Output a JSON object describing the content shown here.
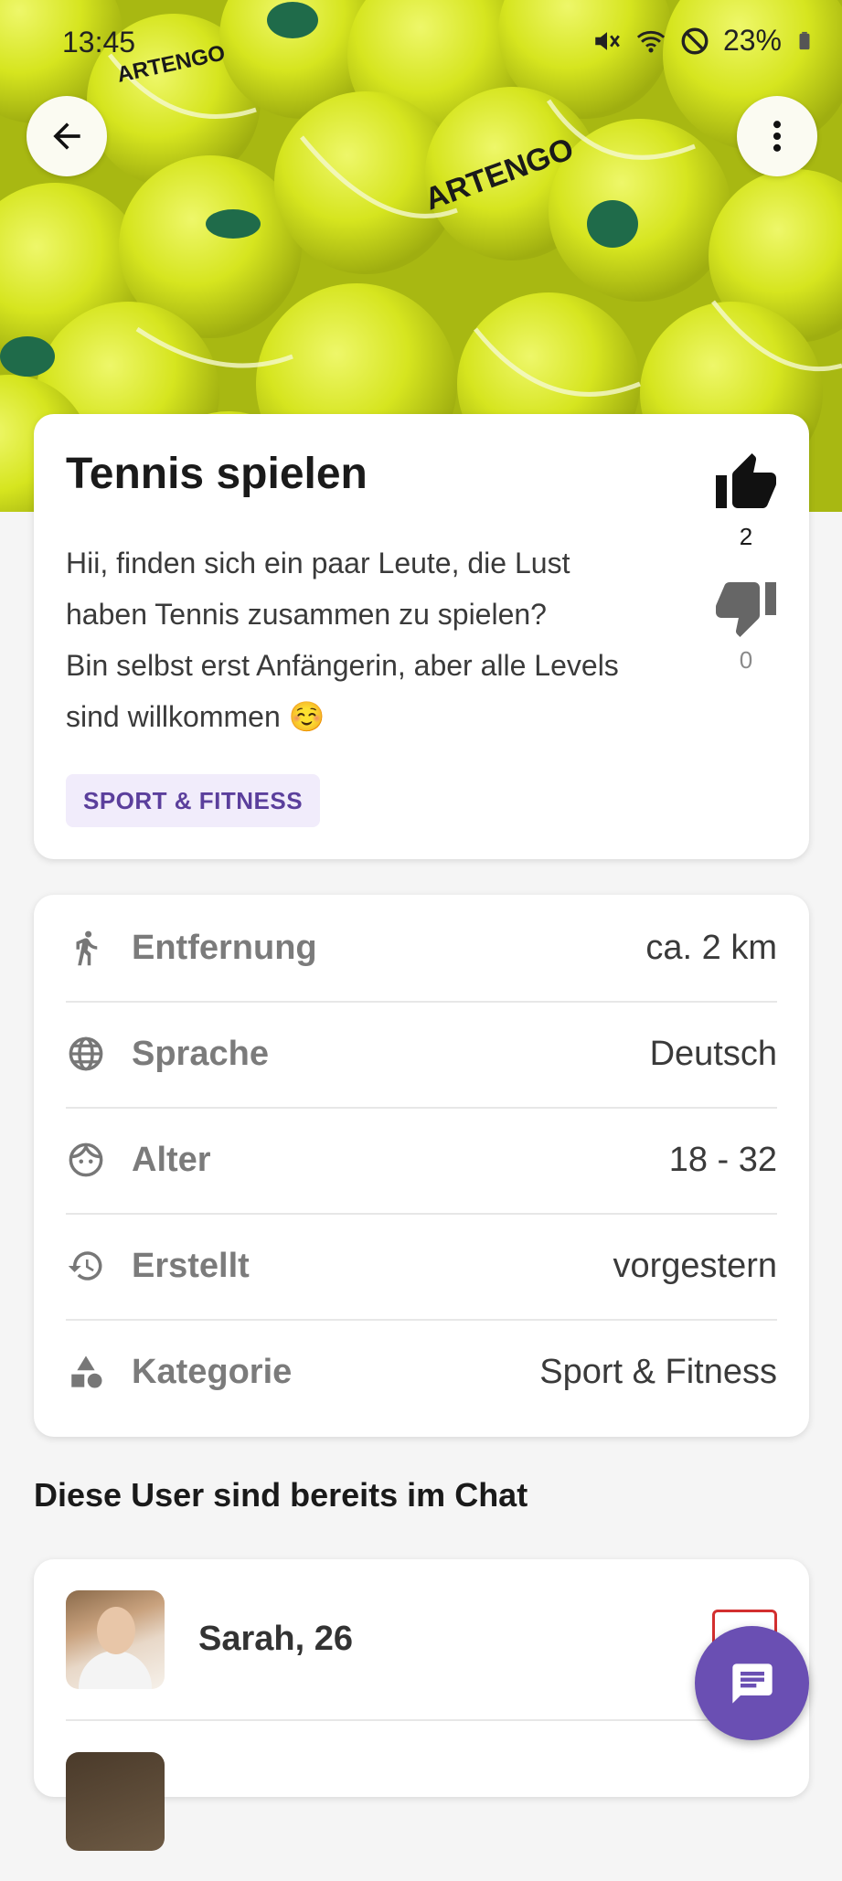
{
  "status_bar": {
    "time": "13:45",
    "battery": "23%"
  },
  "header": {
    "back_icon": "arrow-left-icon",
    "more_icon": "more-vert-icon",
    "hero_image": "tennis-balls-photo"
  },
  "post": {
    "title": "Tennis spielen",
    "description": "Hii, finden sich ein paar Leute, die Lust\nhaben Tennis zusammen zu spielen?\nBin selbst erst Anfängerin, aber alle Levels\nsind willkommen ☺️",
    "tag": "SPORT & FITNESS",
    "likes": "2",
    "dislikes": "0"
  },
  "details": [
    {
      "icon": "walking-icon",
      "label": "Entfernung",
      "value": "ca. 2 km"
    },
    {
      "icon": "globe-icon",
      "label": "Sprache",
      "value": "Deutsch"
    },
    {
      "icon": "face-icon",
      "label": "Alter",
      "value": "18 - 32"
    },
    {
      "icon": "history-icon",
      "label": "Erstellt",
      "value": "vorgestern"
    },
    {
      "icon": "category-icon",
      "label": "Kategorie",
      "value": "Sport & Fitness"
    }
  ],
  "users_section": {
    "title": "Diese User sind bereits im Chat",
    "users": [
      {
        "name": "Sarah, 26",
        "badge": "Ad"
      }
    ]
  },
  "fab": {
    "icon": "chat-icon"
  },
  "colors": {
    "accent": "#6a4fb3",
    "tag_bg": "#f1ecfb",
    "tag_text": "#5b3f9c",
    "admin": "#d32f2f",
    "hero": "#c9dc1e"
  }
}
